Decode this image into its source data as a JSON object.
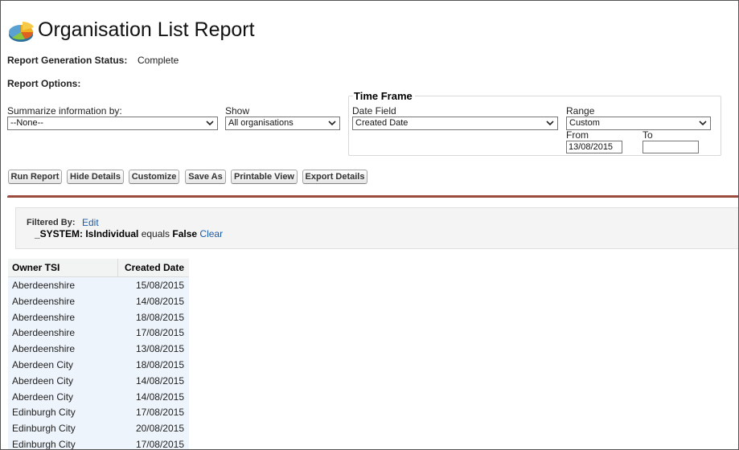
{
  "header": {
    "title": "Organisation List Report",
    "status_label": "Report Generation Status:",
    "status_value": "Complete",
    "options_label": "Report Options:"
  },
  "options": {
    "summarize_label": "Summarize information by:",
    "summarize_value": "--None--",
    "show_label": "Show",
    "show_value": "All organisations"
  },
  "time_frame": {
    "title": "Time Frame",
    "date_field_label": "Date Field",
    "date_field_value": "Created Date",
    "range_label": "Range",
    "range_value": "Custom",
    "from_label": "From",
    "from_value": "13/08/2015",
    "to_label": "To",
    "to_value": ""
  },
  "toolbar": {
    "run_report": "Run Report",
    "hide_details": "Hide Details",
    "customize": "Customize",
    "save_as": "Save As",
    "printable_view": "Printable View",
    "export_details": "Export Details"
  },
  "filter": {
    "label": "Filtered By:",
    "edit": "Edit",
    "field": "_SYSTEM: IsIndividual",
    "operator": " equals ",
    "value": "False",
    "clear": " Clear"
  },
  "table": {
    "columns": [
      "Owner TSI",
      "Created Date"
    ],
    "rows": [
      {
        "owner": "Aberdeenshire",
        "date": "15/08/2015"
      },
      {
        "owner": "Aberdeenshire",
        "date": "14/08/2015"
      },
      {
        "owner": "Aberdeenshire",
        "date": "18/08/2015"
      },
      {
        "owner": "Aberdeenshire",
        "date": "17/08/2015"
      },
      {
        "owner": "Aberdeenshire",
        "date": "13/08/2015"
      },
      {
        "owner": "Aberdeen City",
        "date": "18/08/2015"
      },
      {
        "owner": "Aberdeen City",
        "date": "14/08/2015"
      },
      {
        "owner": "Aberdeen City",
        "date": "14/08/2015"
      },
      {
        "owner": "Edinburgh City",
        "date": "17/08/2015"
      },
      {
        "owner": "Edinburgh City",
        "date": "20/08/2015"
      },
      {
        "owner": "Edinburgh City",
        "date": "17/08/2015"
      }
    ]
  },
  "colors": {
    "divider": "#9b4b3e",
    "link": "#1a5ba6",
    "table_body": "#eef4fb"
  },
  "icons": {
    "report": "pie-chart-icon",
    "dropdown": "chevron-down-icon"
  }
}
